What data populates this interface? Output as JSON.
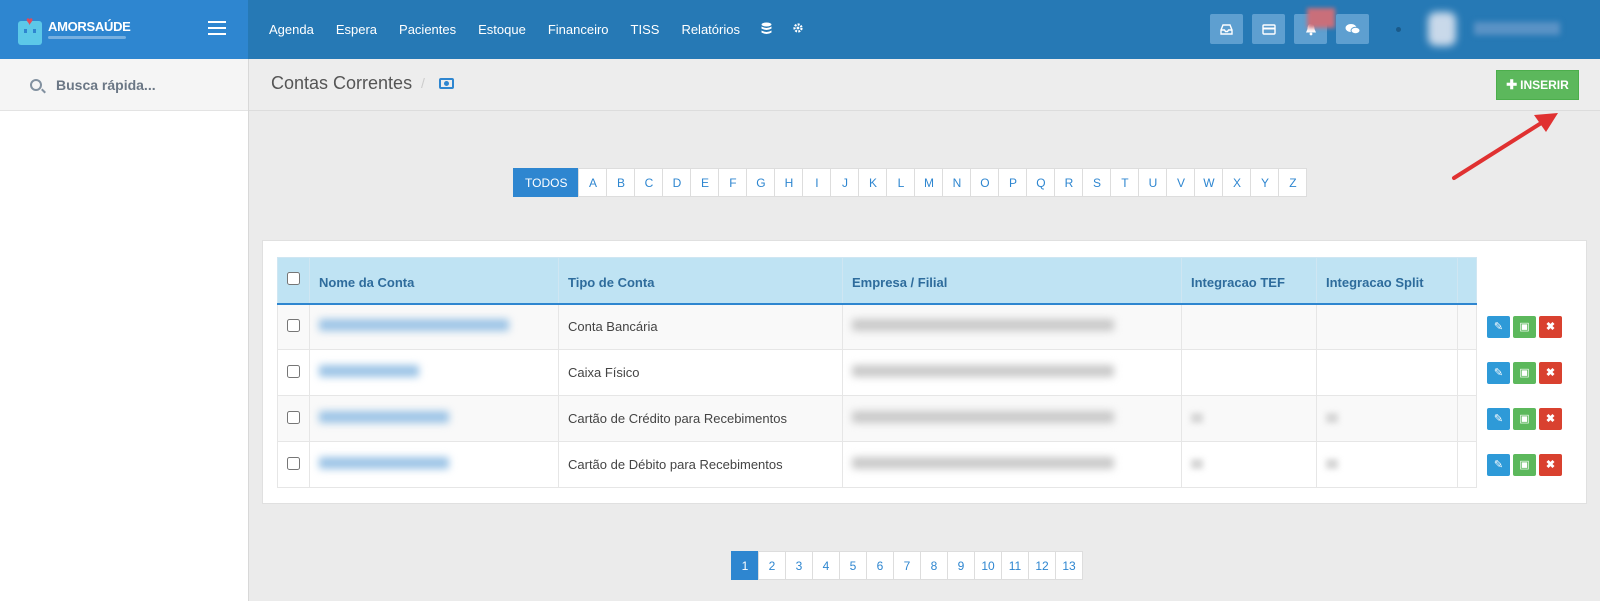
{
  "brand": {
    "name": "AMORSAÚDE"
  },
  "nav": {
    "items": [
      "Agenda",
      "Espera",
      "Pacientes",
      "Estoque",
      "Financeiro",
      "TISS",
      "Relatórios"
    ],
    "icons": [
      "database-icon",
      "gear-icon"
    ]
  },
  "toolbar": {
    "icons": [
      "inbox-icon",
      "card-icon",
      "bell-icon",
      "chat-icon"
    ]
  },
  "sidebar": {
    "search_placeholder": "Busca rápida..."
  },
  "page": {
    "title": "Contas Correntes",
    "breadcrumb_sep": "/",
    "insert_label": "INSERIR"
  },
  "filter": {
    "letters": [
      "TODOS",
      "A",
      "B",
      "C",
      "D",
      "E",
      "F",
      "G",
      "H",
      "I",
      "J",
      "K",
      "L",
      "M",
      "N",
      "O",
      "P",
      "Q",
      "R",
      "S",
      "T",
      "U",
      "V",
      "W",
      "X",
      "Y",
      "Z"
    ],
    "active": "TODOS"
  },
  "table": {
    "headers": [
      "Nome da Conta",
      "Tipo de Conta",
      "Empresa / Filial",
      "Integracao TEF",
      "Integracao Split"
    ],
    "rows": [
      {
        "tipo": "Conta Bancária"
      },
      {
        "tipo": "Caixa Físico"
      },
      {
        "tipo": "Cartão de Crédito para Recebimentos"
      },
      {
        "tipo": "Cartão de Débito para Recebimentos"
      }
    ]
  },
  "pagination": {
    "pages": [
      "1",
      "2",
      "3",
      "4",
      "5",
      "6",
      "7",
      "8",
      "9",
      "10",
      "11",
      "12",
      "13"
    ],
    "current": "1"
  },
  "colors": {
    "topbar": "#2679b5",
    "accent": "#2e86d0",
    "success": "#5cb85c",
    "danger": "#d9412f",
    "annotation": "#e03131"
  }
}
